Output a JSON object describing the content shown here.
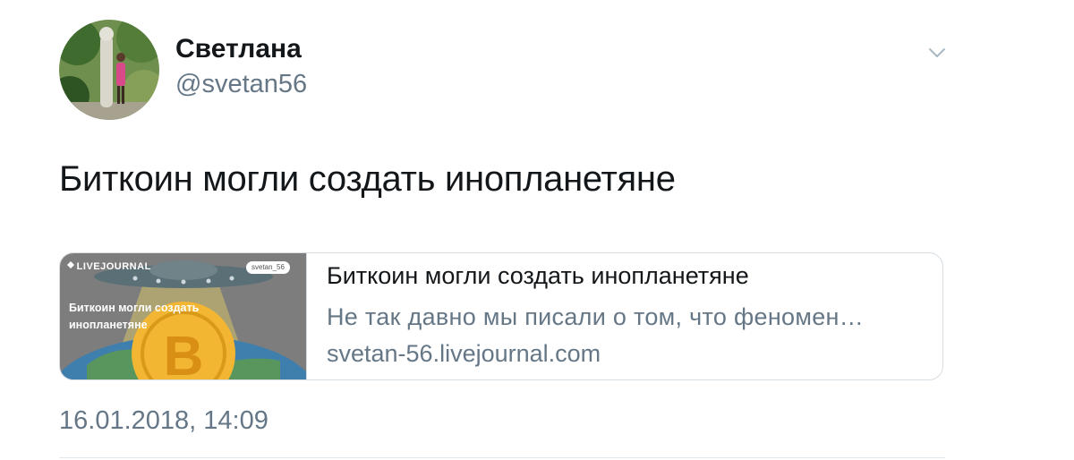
{
  "tweet": {
    "display_name": "Светлана",
    "handle": "@svetan56",
    "text": "Биткоин могли создать инопланетяне",
    "timestamp": "16.01.2018, 14:09",
    "icons": {
      "avatar": "profile-photo-avatar",
      "menu": "chevron-down-icon"
    }
  },
  "card": {
    "title": "Биткоин могли создать инопланетяне",
    "description": "Не так давно мы писали о том, что феномен…",
    "domain": "svetan-56.livejournal.com",
    "thumbnail": {
      "brand": "LIVEJOURNAL",
      "user_badge": "svetan_56",
      "title": "Биткоин могли создать инопланетяне",
      "coin_symbol": "B"
    }
  },
  "colors": {
    "primary_text": "#14171a",
    "secondary_text": "#657786",
    "border": "#d6dde3",
    "coin": "#f2b632"
  }
}
